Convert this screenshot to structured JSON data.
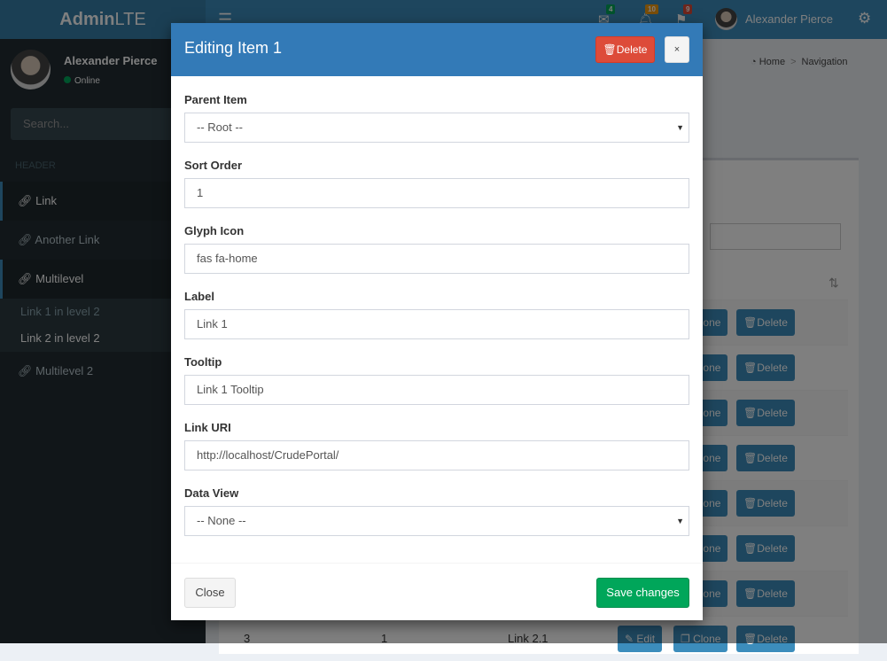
{
  "app": {
    "logo_bold": "Admin",
    "logo_rest": "LTE"
  },
  "navbar": {
    "messages_count": "4",
    "notifications_count": "10",
    "flags_count": "9",
    "user": "Alexander Pierce"
  },
  "sidebar": {
    "user": "Alexander Pierce",
    "status": "Online",
    "search_placeholder": "Search...",
    "header": "HEADER",
    "items": [
      {
        "label": "Link"
      },
      {
        "label": "Another Link"
      },
      {
        "label": "Multilevel"
      },
      {
        "label": "Multilevel 2"
      }
    ],
    "subitems": [
      {
        "label": "Link 1 in level 2"
      },
      {
        "label": "Link 2 in level 2"
      }
    ]
  },
  "breadcrumb": {
    "home": "Home",
    "current": "Navigation"
  },
  "table": {
    "search_label": ":",
    "edit": "Edit",
    "clone": "Clone",
    "delete": "Delete",
    "last_row": [
      "3",
      "1",
      "Link 2.1"
    ]
  },
  "modal": {
    "title": "Editing Item 1",
    "delete": "Delete",
    "close_x": "×",
    "fields": {
      "parent_label": "Parent Item",
      "parent_value": "-- Root --",
      "sort_label": "Sort Order",
      "sort_value": "1",
      "glyph_label": "Glyph Icon",
      "glyph_value": "fas fa-home",
      "label_label": "Label",
      "label_value": "Link 1",
      "tooltip_label": "Tooltip",
      "tooltip_value": "Link 1 Tooltip",
      "uri_label": "Link URI",
      "uri_value": "http://localhost/CrudePortal/",
      "view_label": "Data View",
      "view_value": "-- None --"
    },
    "close": "Close",
    "save": "Save changes"
  },
  "colors": {
    "primary": "#3c8dbc",
    "modal_header": "#337ab7",
    "danger": "#dd4b39",
    "success": "#00a65a"
  }
}
